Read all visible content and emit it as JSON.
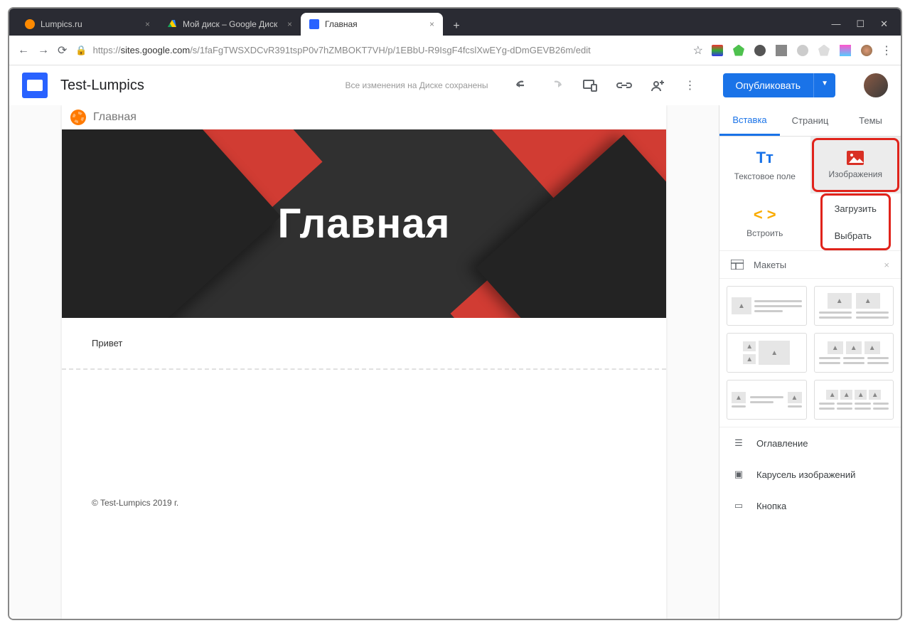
{
  "browser": {
    "tabs": [
      {
        "title": "Lumpics.ru",
        "active": false
      },
      {
        "title": "Мой диск – Google Диск",
        "active": false
      },
      {
        "title": "Главная",
        "active": true
      }
    ],
    "url_prefix": "https://",
    "url_domain": "sites.google.com",
    "url_path": "/s/1faFgTWSXDCvR391tspP0v7hZMBOKT7VH/p/1EBbU-R9IsgF4fcslXwEYg-dDmGEVB26m/edit"
  },
  "app": {
    "title": "Test-Lumpics",
    "saved_msg": "Все изменения на Диске сохранены",
    "publish": "Опубликовать"
  },
  "canvas": {
    "site_bar_title": "Главная",
    "hero_title": "Главная",
    "body_text": "Привет",
    "footer": "© Test-Lumpics 2019 г."
  },
  "sidebar": {
    "tabs": {
      "insert": "Вставка",
      "pages": "Страниц",
      "themes": "Темы"
    },
    "cells": {
      "text": "Текстовое поле",
      "image": "Изображения",
      "embed": "Встроить"
    },
    "drop": {
      "upload": "Загрузить",
      "choose": "Выбрать"
    },
    "layouts_hdr": "Макеты",
    "items": {
      "toc": "Оглавление",
      "carousel": "Карусель изображений",
      "button": "Кнопка"
    }
  }
}
